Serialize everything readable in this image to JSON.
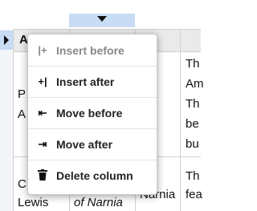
{
  "table": {
    "cells": [
      {
        "text": "A",
        "row": "header"
      },
      {
        "text": "Th",
        "row": "r1c3a"
      },
      {
        "text": "Am",
        "row": "r1c3b"
      },
      {
        "text": "P",
        "row": "r1c0a"
      },
      {
        "text": "A",
        "row": "r1c0b"
      },
      {
        "text": "Th",
        "row": "r1c3c"
      },
      {
        "text": "be",
        "row": "r1c3d"
      },
      {
        "text": "bu",
        "row": "r1c3e"
      },
      {
        "text": "C",
        "row": "r2c0a"
      },
      {
        "text": "Lewis",
        "row": "r2c0b"
      },
      {
        "text": "of Narnia",
        "row": "r2c1"
      },
      {
        "text": "Narnia",
        "row": "r2c2"
      },
      {
        "text": "Th",
        "row": "r2c3a"
      },
      {
        "text": "fea",
        "row": "r2c3b"
      }
    ]
  },
  "context_menu": {
    "items": [
      {
        "icon": "insert-before-icon",
        "glyph": "|+",
        "label": "Insert before",
        "enabled": false
      },
      {
        "icon": "insert-after-icon",
        "glyph": "+|",
        "label": "Insert after",
        "enabled": true
      },
      {
        "icon": "move-before-icon",
        "glyph": "⇤",
        "label": "Move before",
        "enabled": true
      },
      {
        "icon": "move-after-icon",
        "glyph": "⇥",
        "label": "Move after",
        "enabled": true
      },
      {
        "icon": "trash-icon",
        "glyph": "🗑",
        "label": "Delete column",
        "enabled": true
      }
    ]
  },
  "colors": {
    "handle_selected": "#c9dcf5",
    "header_bg": "#eaeaea",
    "disabled_text": "#888888"
  }
}
